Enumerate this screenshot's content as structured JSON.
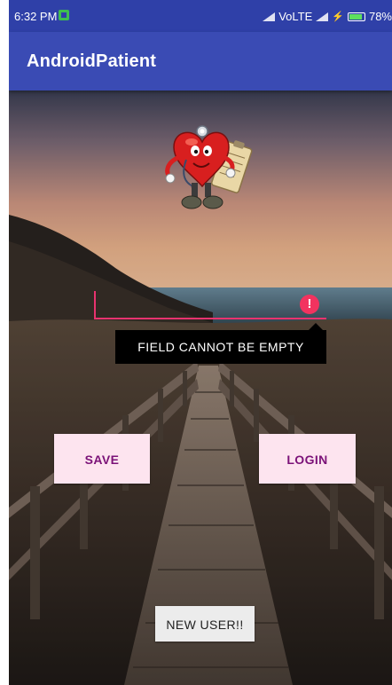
{
  "status_bar": {
    "time": "6:32 PM",
    "network_label": "VoLTE",
    "battery_percent": "78%"
  },
  "app_bar": {
    "title": "AndroidPatient"
  },
  "form": {
    "input_value": "",
    "error_message": "FIELD CANNOT BE EMPTY",
    "error_icon_glyph": "!"
  },
  "buttons": {
    "save_label": "SAVE",
    "login_label": "LOGIN",
    "new_user_label": "NEW USER!!"
  },
  "colors": {
    "status_bar": "#2f40a8",
    "app_bar": "#3a4bb4",
    "accent": "#e8336f",
    "button_bg": "#fde4ef",
    "button_text": "#7b1278"
  },
  "icons": {
    "logo": "doctor-heart-mascot-icon",
    "error": "error-alert-icon",
    "sim": "sim-card-icon",
    "signal": "signal-strength-icon",
    "battery": "battery-icon"
  }
}
